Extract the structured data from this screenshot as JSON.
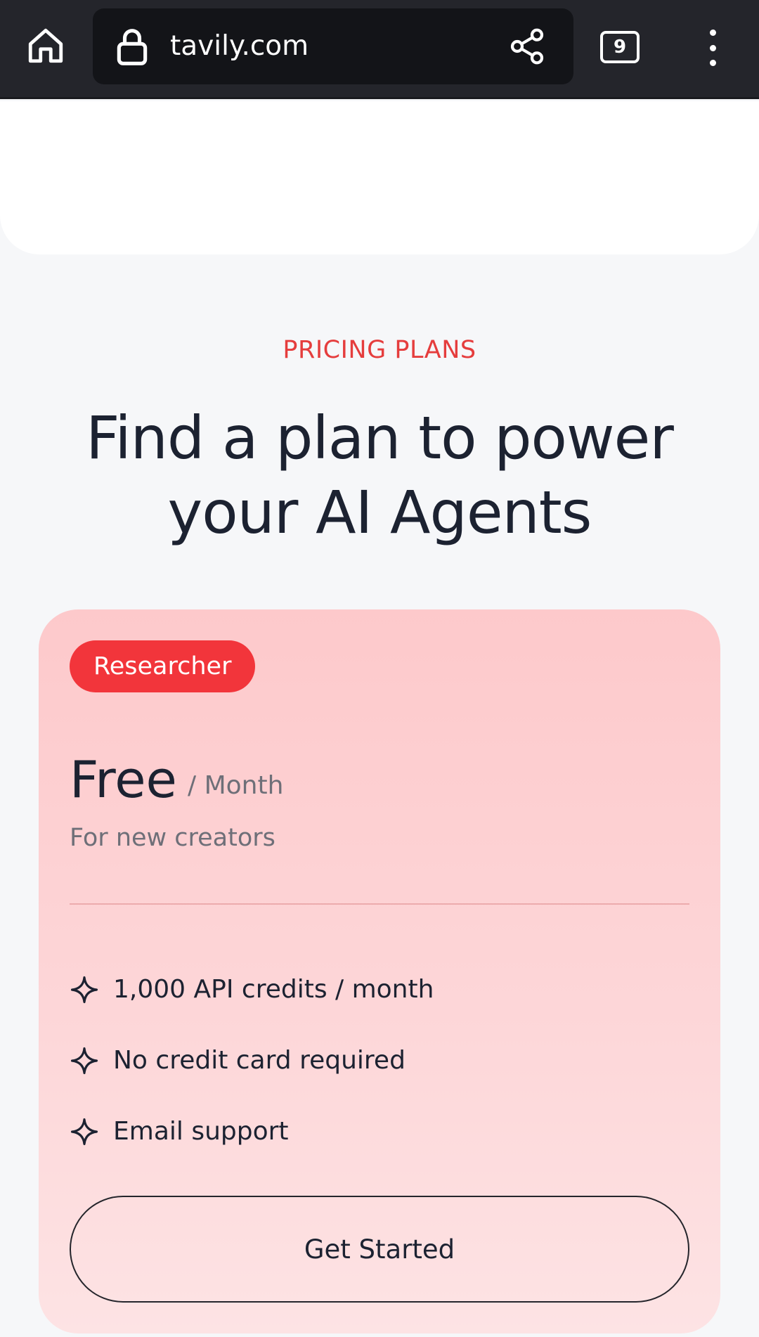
{
  "browser": {
    "url": "tavily.com",
    "tab_count": "9"
  },
  "pricing": {
    "eyebrow": "PRICING PLANS",
    "headline": "Find a plan to power your AI Agents"
  },
  "plan": {
    "badge": "Researcher",
    "price": "Free",
    "period": "/ Month",
    "subtitle": "For new creators",
    "features": [
      "1,000 API credits / month",
      "No credit card required",
      "Email support"
    ],
    "cta_label": "Get Started"
  },
  "colors": {
    "accent": "#f2353b",
    "eyebrow": "#e53d3d",
    "card_bg": "#fdc9cb",
    "browser_bar": "#24252b"
  }
}
